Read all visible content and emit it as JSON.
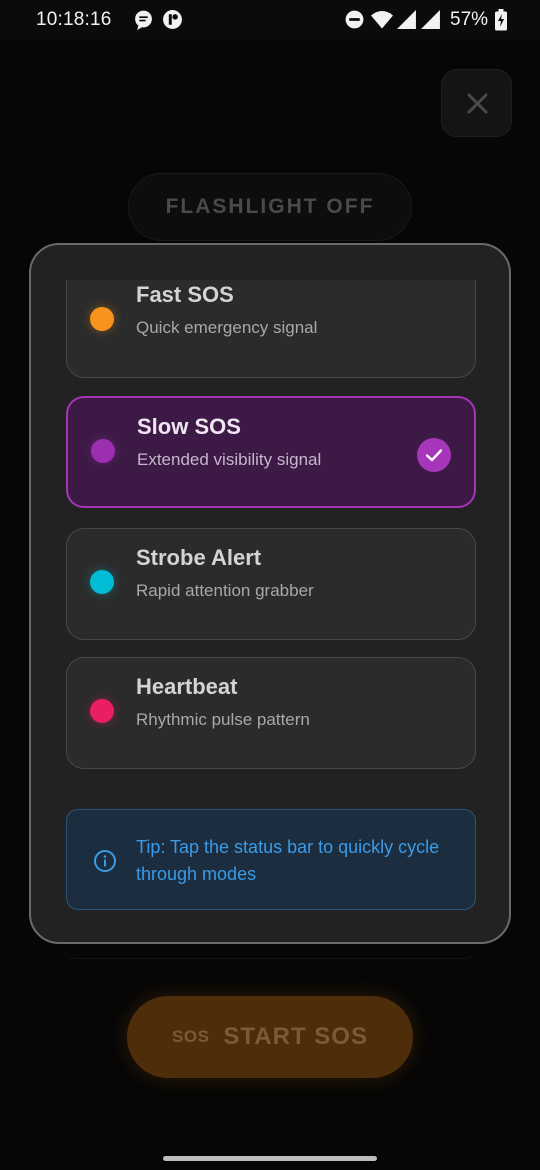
{
  "status_bar": {
    "time": "10:18:16",
    "battery": "57%",
    "icons": [
      "chat-bubble-icon",
      "app-notification-icon",
      "do-not-disturb-icon",
      "wifi-icon",
      "cell-signal-x-icon",
      "cell-signal-icon",
      "battery-charging-icon"
    ]
  },
  "background": {
    "close_icon": "close-icon",
    "flashlight_label": "FLASHLIGHT OFF",
    "sos_mark": "SOS",
    "sos_label": "START SOS"
  },
  "modes": [
    {
      "title": "Fast SOS",
      "subtitle": "Quick emergency signal",
      "color": "#f7941d",
      "selected": false
    },
    {
      "title": "Slow SOS",
      "subtitle": "Extended visibility signal",
      "color": "#9b2fb0",
      "selected": true
    },
    {
      "title": "Strobe Alert",
      "subtitle": "Rapid attention grabber",
      "color": "#00bcd4",
      "selected": false
    },
    {
      "title": "Heartbeat",
      "subtitle": "Rhythmic pulse pattern",
      "color": "#e91e63",
      "selected": false
    }
  ],
  "tip": {
    "icon": "info-icon",
    "text": "Tip: Tap the status bar to quickly cycle through modes"
  },
  "colors": {
    "accent": "#a535b8",
    "tip_text": "#3a9be8",
    "sos_button": "#4e2d0a"
  }
}
